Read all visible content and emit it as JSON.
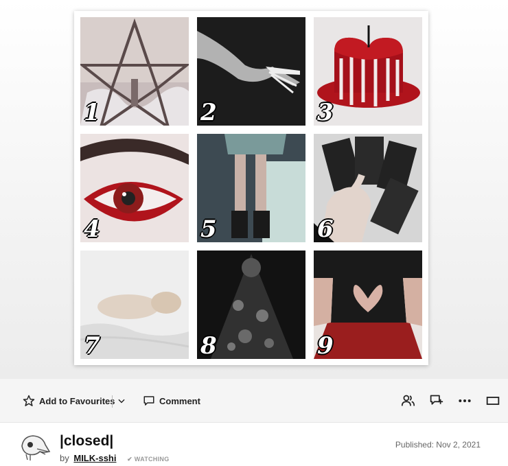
{
  "gallery": {
    "tiles": [
      {
        "number": "1",
        "subject": "pentagram"
      },
      {
        "number": "2",
        "subject": "pale hand"
      },
      {
        "number": "3",
        "subject": "bleeding heart candle"
      },
      {
        "number": "4",
        "subject": "red eye makeup"
      },
      {
        "number": "5",
        "subject": "legs in boots"
      },
      {
        "number": "6",
        "subject": "tarot cards"
      },
      {
        "number": "7",
        "subject": "doll on bed"
      },
      {
        "number": "8",
        "subject": "lace veil"
      },
      {
        "number": "9",
        "subject": "heart cutout top"
      }
    ]
  },
  "toolbar": {
    "favourite_label": "Add to Favourites",
    "comment_label": "Comment",
    "icons": [
      "star-icon",
      "chevron-down-icon",
      "comment-icon",
      "people-icon",
      "gift-icon",
      "more-icon",
      "fullscreen-icon"
    ]
  },
  "deviation": {
    "title": "|closed|",
    "by_label": "by",
    "author": "MILK-sshi",
    "watching_label": "WATCHING",
    "published": "Published: Nov 2, 2021"
  },
  "colors": {
    "accent_red": "#b0141c",
    "toolbar_bg": "#f5f5f5"
  }
}
